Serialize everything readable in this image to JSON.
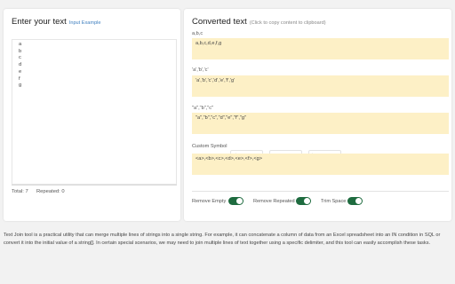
{
  "left": {
    "title": "Enter your text",
    "example_link": "Input Example",
    "lines": [
      "a",
      "b",
      "c",
      "d",
      "e",
      "f",
      "g"
    ],
    "total_label": "Total: 7",
    "repeated_label": "Repeated: 0"
  },
  "right": {
    "title": "Converted text",
    "hint": "(Click to copy content to clipboard)",
    "sections": [
      {
        "label": "a,b,c",
        "output": "a,b,c,d,e,f,g"
      },
      {
        "label": "'a','b','c'",
        "output": "'a','b','c','d','e','f','g'"
      },
      {
        "label": "\"a\",\"b\",\"c\"",
        "output": "\"a\",\"b\",\"c\",\"d\",\"e\",\"f\",\"g\""
      }
    ],
    "custom": {
      "label": "Custom Symbol",
      "prefix": "<",
      "separator": ",",
      "suffix": ">",
      "output": "<a>,<b>,<c>,<d>,<e>,<f>,<g>"
    },
    "toggles": [
      {
        "label": "Remove Empty",
        "on": true
      },
      {
        "label": "Remove Repeated",
        "on": true
      },
      {
        "label": "Trim Space",
        "on": true
      }
    ]
  },
  "description": "Text Join tool is a practical utility that can merge multiple lines of strings into a single string. For example, it can concatenate a column of data from an Excel spreadsheet into an IN condition in SQL or convert it into the initial value of a string[]. In certain special scenarios, we may need to join multiple lines of text together using a specific delimiter, and this tool can easily accomplish these tasks.",
  "colors": {
    "output_bg": "#fdf0c6",
    "toggle_on": "#1e6b3f",
    "link": "#3f7fbf",
    "page_bg": "#f2f2f2"
  }
}
